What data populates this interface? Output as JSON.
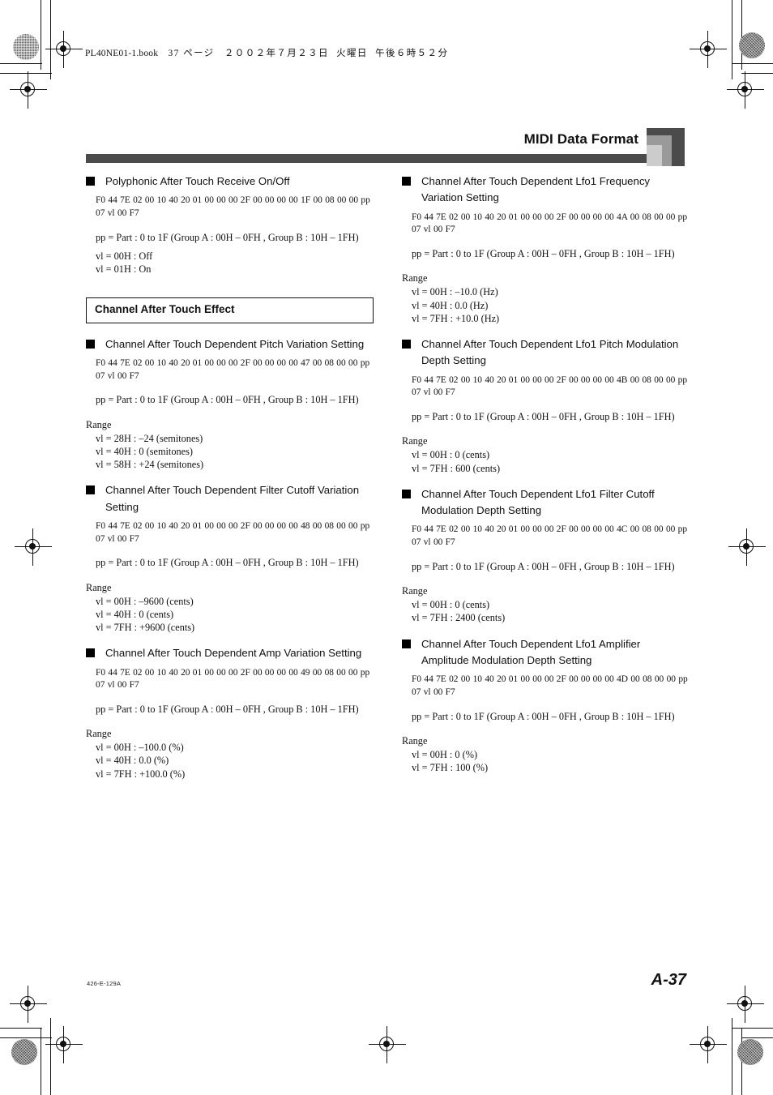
{
  "print_marks": {
    "file_stamp": {
      "book": "PL40NE01-1.book",
      "page": "37 ページ",
      "date": "２００２年７月２３日",
      "weekday": "火曜日",
      "time": "午後６時５２分"
    }
  },
  "header": {
    "title": "MIDI Data Format"
  },
  "footer": {
    "code": "426-E-129A",
    "page_number": "A-37"
  },
  "common": {
    "part_line": "pp = Part : 0 to 1F (Group A : 00H – 0FH , Group B : 10H – 1FH)",
    "range_label": "Range"
  },
  "left_column": {
    "entries": [
      {
        "title": "Polyphonic After Touch Receive On/Off",
        "sysex": "F0 44 7E 02 00 10 40 20 01 00 00 00 2F 00 00 00 00 1F  00 08 00 00 pp 07 vl 00 F7",
        "part_line": "pp = Part : 0 to 1F (Group A : 00H – 0FH , Group B : 10H – 1FH)",
        "range_label": "",
        "values": [
          "vl = 00H : Off",
          "vl = 01H : On"
        ]
      }
    ],
    "section": {
      "title": "Channel After Touch Effect",
      "entries": [
        {
          "title": "Channel After Touch Dependent Pitch Variation Setting",
          "sysex": "F0 44 7E 02 00 10 40 20 01 00 00 00 2F 00 00 00 00 47 00 08 00 00 pp 07 vl 00 F7",
          "part_line": "pp = Part : 0 to 1F (Group A : 00H – 0FH , Group B : 10H – 1FH)",
          "range_label": "Range",
          "values": [
            "vl = 28H : –24 (semitones)",
            "vl = 40H : 0 (semitones)",
            "vl = 58H : +24 (semitones)"
          ]
        },
        {
          "title": "Channel After Touch Dependent Filter Cutoff Variation Setting",
          "sysex": "F0 44 7E 02 00 10 40 20 01 00 00 00 2F 00 00 00 00 48 00 08 00 00 pp 07 vl 00 F7",
          "part_line": "pp = Part : 0 to 1F (Group A : 00H – 0FH , Group B : 10H – 1FH)",
          "range_label": "Range",
          "values": [
            "vl = 00H : –9600 (cents)",
            "vl = 40H : 0 (cents)",
            "vl = 7FH : +9600 (cents)"
          ]
        },
        {
          "title": "Channel After Touch Dependent Amp Variation Setting",
          "sysex": "F0 44 7E 02 00 10 40 20 01 00 00 00 2F 00 00 00 00 49 00 08 00 00 pp 07 vl 00 F7",
          "part_line": "pp = Part : 0 to 1F (Group A : 00H – 0FH , Group B : 10H – 1FH)",
          "range_label": "Range",
          "values": [
            "vl = 00H : –100.0 (%)",
            "vl = 40H : 0.0 (%)",
            "vl = 7FH : +100.0 (%)"
          ]
        }
      ]
    }
  },
  "right_column": {
    "entries": [
      {
        "title": "Channel After Touch Dependent Lfo1 Frequency Variation Setting",
        "sysex": "F0 44 7E 02 00 10 40 20 01 00 00 00 2F 00 00 00 00 4A 00 08 00 00 pp 07 vl 00 F7",
        "part_line": "pp = Part : 0 to 1F (Group A : 00H – 0FH , Group B : 10H – 1FH)",
        "range_label": "Range",
        "values": [
          "vl = 00H : –10.0 (Hz)",
          "vl = 40H : 0.0 (Hz)",
          "vl = 7FH : +10.0 (Hz)"
        ]
      },
      {
        "title": "Channel After Touch Dependent Lfo1 Pitch Modulation Depth Setting",
        "sysex": "F0 44 7E 02 00 10 40 20 01 00 00 00 2F 00 00 00 00 4B 00 08 00 00 pp 07 vl 00 F7",
        "part_line": "pp = Part : 0 to 1F (Group A : 00H – 0FH , Group B : 10H – 1FH)",
        "range_label": "Range",
        "values": [
          "vl = 00H : 0 (cents)",
          "vl = 7FH : 600 (cents)"
        ]
      },
      {
        "title": "Channel After Touch Dependent Lfo1 Filter Cutoff Modulation Depth Setting",
        "sysex": "F0 44 7E 02 00 10 40 20 01 00 00 00 2F 00 00 00 00 4C 00 08 00 00 pp 07 vl 00 F7",
        "part_line": "pp = Part : 0 to 1F (Group A : 00H – 0FH , Group B : 10H – 1FH)",
        "range_label": "Range",
        "values": [
          "vl = 00H : 0 (cents)",
          "vl = 7FH : 2400 (cents)"
        ]
      },
      {
        "title": "Channel After Touch Dependent Lfo1 Amplifier Amplitude Modulation Depth Setting",
        "sysex": "F0 44 7E 02 00 10 40 20 01 00 00 00 2F 00 00 00 00 4D 00 08 00 00 pp 07 vl 00 F7",
        "part_line": "pp = Part : 0 to 1F (Group A : 00H – 0FH , Group B : 10H – 1FH)",
        "range_label": "Range",
        "values": [
          "vl = 00H : 0 (%)",
          "vl = 7FH : 100 (%)"
        ]
      }
    ]
  }
}
